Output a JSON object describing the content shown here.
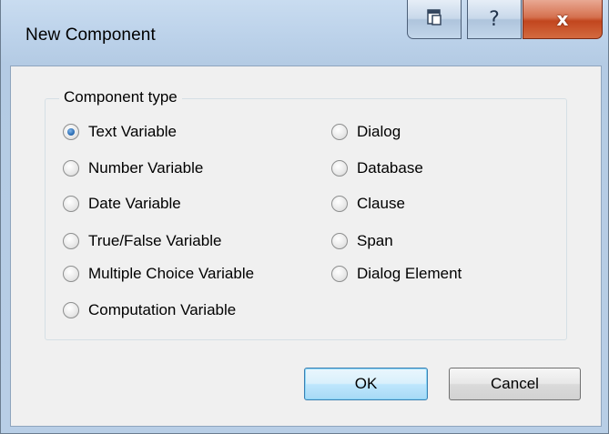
{
  "window": {
    "title": "New Component"
  },
  "caption_buttons": {
    "restore_icon": "restore-icon",
    "help_label": "?",
    "close_label": "x"
  },
  "group": {
    "legend": "Component type",
    "left_options": [
      {
        "label": "Text Variable",
        "checked": true
      },
      {
        "label": "Number Variable",
        "checked": false
      },
      {
        "label": "Date Variable",
        "checked": false
      },
      {
        "label": "True/False Variable",
        "checked": false
      },
      {
        "label": "Multiple Choice Variable",
        "checked": false
      },
      {
        "label": "Computation Variable",
        "checked": false
      }
    ],
    "right_options": [
      {
        "label": "Dialog",
        "checked": false
      },
      {
        "label": "Database",
        "checked": false
      },
      {
        "label": "Clause",
        "checked": false
      },
      {
        "label": "Span",
        "checked": false
      },
      {
        "label": "Dialog Element",
        "checked": false
      }
    ]
  },
  "buttons": {
    "ok": "OK",
    "cancel": "Cancel"
  }
}
